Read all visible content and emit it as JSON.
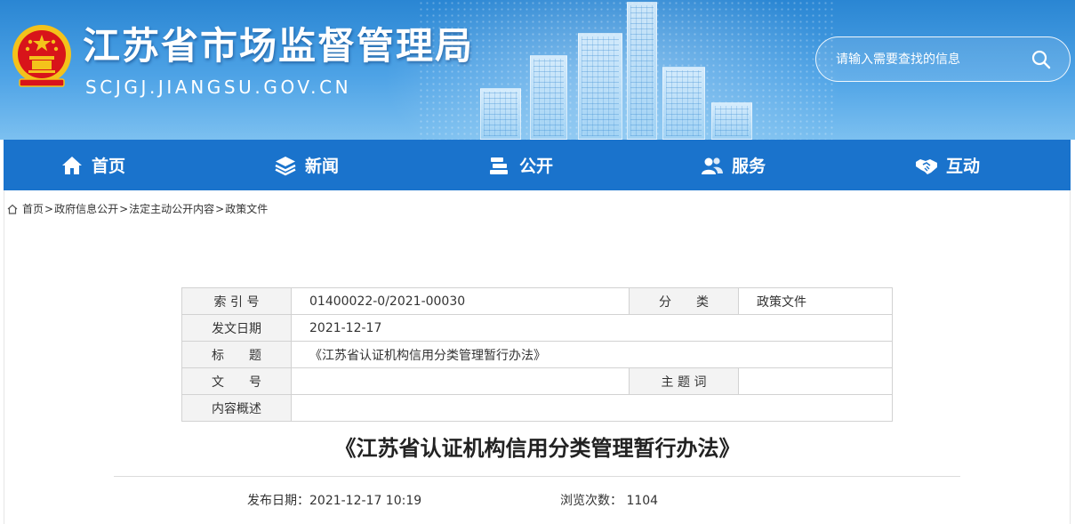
{
  "header": {
    "site_title": "江苏省市场监督管理局",
    "site_domain": "SCJGJ.JIANGSU.GOV.CN",
    "search_placeholder": "请输入需要查找的信息"
  },
  "nav": {
    "items": [
      {
        "label": "首页",
        "icon": "home-icon"
      },
      {
        "label": "新闻",
        "icon": "layers-icon"
      },
      {
        "label": "公开",
        "icon": "books-icon"
      },
      {
        "label": "服务",
        "icon": "users-icon"
      },
      {
        "label": "互动",
        "icon": "handshake-icon"
      }
    ]
  },
  "breadcrumb": {
    "items": [
      "首页",
      "政府信息公开",
      "法定主动公开内容",
      "政策文件"
    ],
    "separator": ">"
  },
  "meta_table": {
    "index_label": "索 引 号",
    "index_value": "01400022-0/2021-00030",
    "category_label": "分　　类",
    "category_value": "政策文件",
    "date_label": "发文日期",
    "date_value": "2021-12-17",
    "title_label": "标　　题",
    "title_value": "《江苏省认证机构信用分类管理暂行办法》",
    "docno_label": "文　　号",
    "docno_value": "",
    "keywords_label": "主 题 词",
    "keywords_value": "",
    "summary_label": "内容概述",
    "summary_value": ""
  },
  "article": {
    "title": "《江苏省认证机构信用分类管理暂行办法》",
    "publish_label": "发布日期：2021-12-17 10:19",
    "views_label": "浏览次数：",
    "views_value": "1104"
  },
  "colors": {
    "nav_bg": "#1a73cc",
    "header_bg": "#2a86d3",
    "emblem_red": "#d8141a",
    "emblem_gold": "#f4c21b"
  }
}
